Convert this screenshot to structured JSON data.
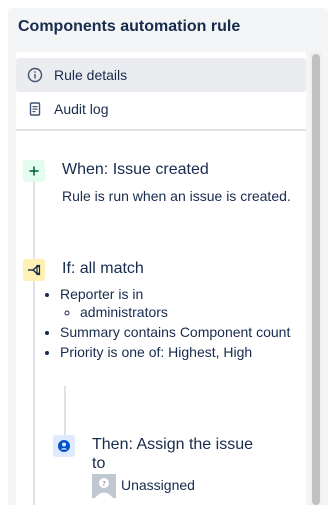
{
  "panel": {
    "title": "Components automation rule"
  },
  "menu": {
    "items": [
      {
        "label": "Rule details",
        "icon": "info-icon",
        "selected": true
      },
      {
        "label": "Audit log",
        "icon": "document-icon",
        "selected": false
      }
    ]
  },
  "trigger": {
    "title": "When: Issue created",
    "description": "Rule is run when an issue is created.",
    "icon": "plus-icon",
    "color": "#e3fcef"
  },
  "condition": {
    "title": "If: all match",
    "icon": "branch-icon",
    "color": "#fff0b3",
    "items": [
      {
        "text": "Reporter is in",
        "sub": "administrators"
      },
      {
        "text": "Summary contains Component count"
      },
      {
        "text": "Priority is one of: Highest, High"
      }
    ]
  },
  "action": {
    "title_line1": "Then: Assign the issue",
    "title_line2": "to",
    "icon": "user-circle-icon",
    "color": "#deebff",
    "assignee": "Unassigned"
  }
}
